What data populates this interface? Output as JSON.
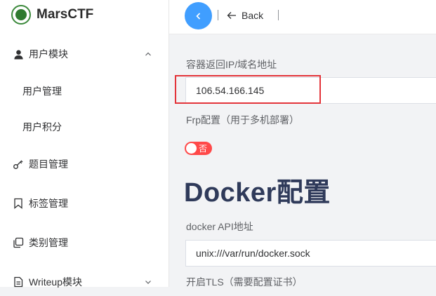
{
  "app": {
    "title": "MarsCTF"
  },
  "sidebar": {
    "items": [
      {
        "label": "用户模块",
        "icon": "user-icon",
        "expanded": true
      },
      {
        "label": "用户管理"
      },
      {
        "label": "用户积分"
      },
      {
        "label": "题目管理",
        "icon": "key-icon"
      },
      {
        "label": "标签管理",
        "icon": "bookmark-icon"
      },
      {
        "label": "类别管理",
        "icon": "copy-icon"
      },
      {
        "label": "Writeup模块",
        "icon": "document-icon",
        "expanded": false
      }
    ]
  },
  "header": {
    "back_label": "Back"
  },
  "form": {
    "container_ip_label": "容器返回IP/域名地址",
    "container_ip_value": "106.54.166.145",
    "frp_label": "Frp配置（用于多机部署）",
    "frp_switch_text": "否",
    "docker_title": "Docker配置",
    "docker_api_label": "docker API地址",
    "docker_api_value": "unix:///var/run/docker.sock",
    "tls_label": "开启TLS（需要配置证书）"
  },
  "colors": {
    "accent": "#409eff",
    "switch_off": "#ff4949",
    "highlight": "#e3343a",
    "title": "#2f3a5a"
  }
}
